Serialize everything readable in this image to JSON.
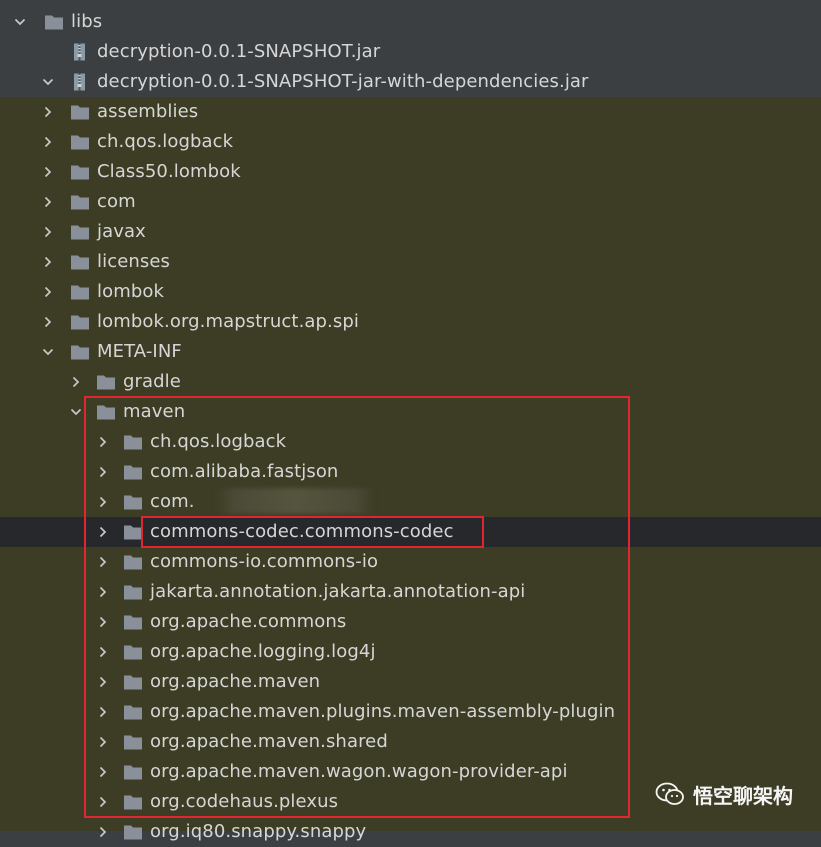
{
  "tree": {
    "rows": [
      {
        "label": "libs",
        "kind": "folder",
        "expanded": true
      },
      {
        "label": "decryption-0.0.1-SNAPSHOT.jar",
        "kind": "jar",
        "expanded": null
      },
      {
        "label": "decryption-0.0.1-SNAPSHOT-jar-with-dependencies.jar",
        "kind": "jar",
        "expanded": true
      },
      {
        "label": "assemblies",
        "kind": "folder",
        "expanded": false
      },
      {
        "label": "ch.qos.logback",
        "kind": "folder",
        "expanded": false
      },
      {
        "label": "Class50.lombok",
        "kind": "folder",
        "expanded": false
      },
      {
        "label": "com",
        "kind": "folder",
        "expanded": false
      },
      {
        "label": "javax",
        "kind": "folder",
        "expanded": false
      },
      {
        "label": "licenses",
        "kind": "folder",
        "expanded": false
      },
      {
        "label": "lombok",
        "kind": "folder",
        "expanded": false
      },
      {
        "label": "lombok.org.mapstruct.ap.spi",
        "kind": "folder",
        "expanded": false
      },
      {
        "label": "META-INF",
        "kind": "folder",
        "expanded": true
      },
      {
        "label": "gradle",
        "kind": "folder",
        "expanded": false
      },
      {
        "label": "maven",
        "kind": "folder",
        "expanded": true
      },
      {
        "label": "ch.qos.logback",
        "kind": "folder",
        "expanded": false
      },
      {
        "label": "com.alibaba.fastjson",
        "kind": "folder",
        "expanded": false
      },
      {
        "label": "com.",
        "kind": "folder",
        "expanded": false,
        "redacted": true
      },
      {
        "label": "commons-codec.commons-codec",
        "kind": "folder",
        "expanded": false,
        "selected": true
      },
      {
        "label": "commons-io.commons-io",
        "kind": "folder",
        "expanded": false
      },
      {
        "label": "jakarta.annotation.jakarta.annotation-api",
        "kind": "folder",
        "expanded": false
      },
      {
        "label": "org.apache.commons",
        "kind": "folder",
        "expanded": false
      },
      {
        "label": "org.apache.logging.log4j",
        "kind": "folder",
        "expanded": false
      },
      {
        "label": "org.apache.maven",
        "kind": "folder",
        "expanded": false
      },
      {
        "label": "org.apache.maven.plugins.maven-assembly-plugin",
        "kind": "folder",
        "expanded": false
      },
      {
        "label": "org.apache.maven.shared",
        "kind": "folder",
        "expanded": false
      },
      {
        "label": "org.apache.maven.wagon.wagon-provider-api",
        "kind": "folder",
        "expanded": false
      },
      {
        "label": "org.codehaus.plexus",
        "kind": "folder",
        "expanded": false
      },
      {
        "label": "org.iq80.snappy.snappy",
        "kind": "folder",
        "expanded": false
      }
    ]
  },
  "watermark": {
    "text": "悟空聊架构",
    "icon": "wechat-icon"
  },
  "colors": {
    "background": "#3c3f41",
    "olive_background": "#3d3d25",
    "selected_row": "#26282c",
    "text": "#d6d6d6",
    "folder": "#8a9099",
    "highlight_box": "#e0262f"
  }
}
